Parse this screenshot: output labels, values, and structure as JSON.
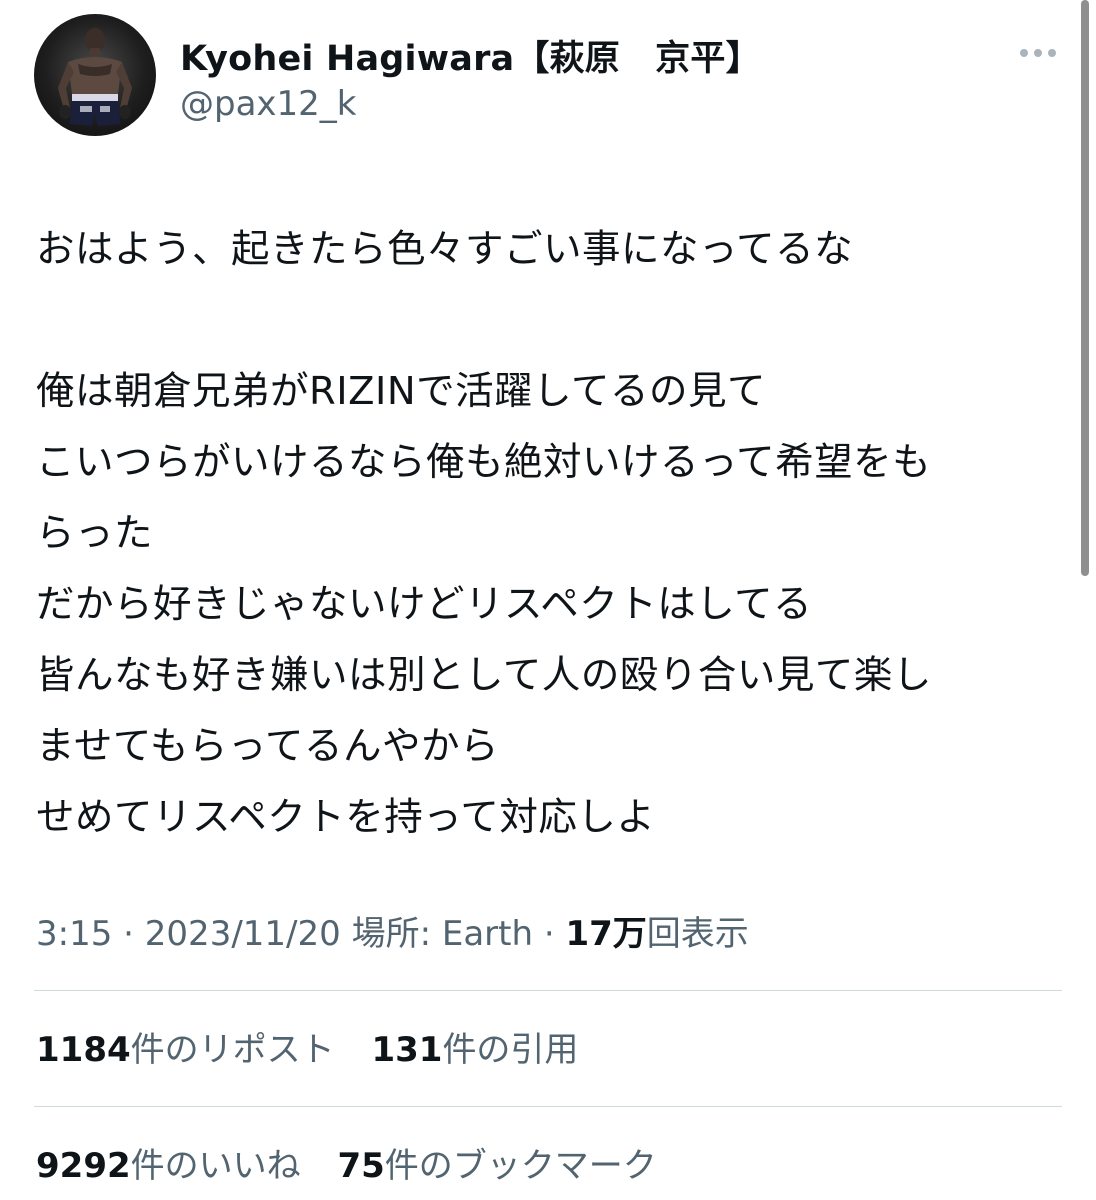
{
  "author": {
    "display_name": "Kyohei Hagiwara【萩原　京平】",
    "handle": "@pax12_k",
    "avatar_icon": "fighter-photo-avatar"
  },
  "menu": {
    "more_icon": "more-dots-icon"
  },
  "tweet": {
    "lines": [
      "おはよう、起きたら色々すごい事になってるな",
      "",
      "俺は朝倉兄弟がRIZINで活躍してるの見て",
      "こいつらがいけるなら俺も絶対いけるって希望をも",
      "らった",
      "だから好きじゃないけどリスペクトはしてる",
      "皆んなも好き嫌いは別として人の殴り合い見て楽し",
      "ませてもらってるんやから",
      "せめてリスペクトを持って対応しよ"
    ]
  },
  "meta": {
    "time": "3:15",
    "separator": " · ",
    "date": "2023/11/20",
    "location": "場所: Earth",
    "views_count": "17万",
    "views_label": "回表示"
  },
  "stats": {
    "reposts": {
      "count": "1184",
      "label": "件のリポスト"
    },
    "quotes": {
      "count": "131",
      "label": "件の引用"
    },
    "likes": {
      "count": "9292",
      "label": "件のいいね"
    },
    "bookmarks": {
      "count": "75",
      "label": "件のブックマーク"
    }
  },
  "colors": {
    "text": "#0f1419",
    "secondary": "#536471",
    "divider": "#cfd9de",
    "scrollbar": "#8f8f8f"
  }
}
